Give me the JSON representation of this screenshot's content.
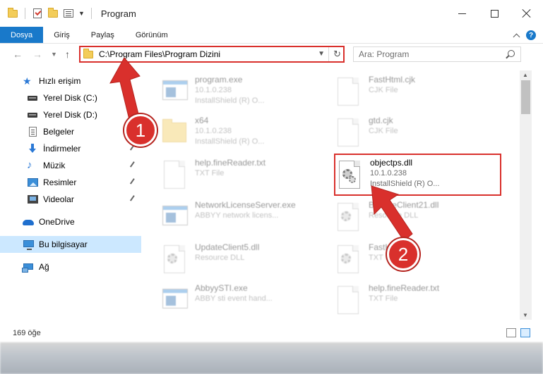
{
  "window": {
    "title": "Program"
  },
  "ribbon": {
    "tabs": [
      "Dosya",
      "Giriş",
      "Paylaş",
      "Görünüm"
    ]
  },
  "address": {
    "path": "C:\\Program Files\\Program Dizini"
  },
  "search": {
    "placeholder": "Ara: Program"
  },
  "sidebar": {
    "items": [
      {
        "label": "Hızlı erişim",
        "icon": "star-icon"
      },
      {
        "label": "Yerel Disk (C:)",
        "icon": "drive-icon"
      },
      {
        "label": "Yerel Disk (D:)",
        "icon": "drive-icon"
      },
      {
        "label": "Belgeler",
        "icon": "documents-icon"
      },
      {
        "label": "İndirmeler",
        "icon": "download-icon"
      },
      {
        "label": "Müzik",
        "icon": "music-icon"
      },
      {
        "label": "Resimler",
        "icon": "pictures-icon"
      },
      {
        "label": "Videolar",
        "icon": "videos-icon"
      },
      {
        "label": "OneDrive",
        "icon": "onedrive-icon"
      },
      {
        "label": "Bu bilgisayar",
        "icon": "computer-icon"
      },
      {
        "label": "Ağ",
        "icon": "network-icon"
      }
    ]
  },
  "files": [
    {
      "name": "program.exe",
      "line1": "10.1.0.238",
      "line2": "InstallShield (R) O...",
      "icon": "exe-icon"
    },
    {
      "name": "FastHtml.cjk",
      "line1": "CJK File",
      "line2": "",
      "icon": "file-icon"
    },
    {
      "name": "x64",
      "line1": "10.1.0.238",
      "line2": "InstallShield (R) O...",
      "icon": "folder-icon"
    },
    {
      "name": "gtd.cjk",
      "line1": "CJK File",
      "line2": "",
      "icon": "file-icon"
    },
    {
      "name": "help.fineReader.txt",
      "line1": "TXT File",
      "line2": "",
      "icon": "file-icon"
    },
    {
      "name": "objectps.dll",
      "line1": "10.1.0.238",
      "line2": "InstallShield (R) O...",
      "icon": "dll-icon"
    },
    {
      "name": "NetworkLicenseServer.exe",
      "line1": "ABBYY network licens...",
      "line2": "",
      "icon": "exe-icon"
    },
    {
      "name": "BrowseClient21.dll",
      "line1": "Resource DLL",
      "line2": "",
      "icon": "dll-icon"
    },
    {
      "name": "UpdateClient5.dll",
      "line1": "Resource DLL",
      "line2": "",
      "icon": "dll-icon"
    },
    {
      "name": "FastKey.dll",
      "line1": "TXT File",
      "line2": "",
      "icon": "dll-icon"
    },
    {
      "name": "AbbyySTI.exe",
      "line1": "ABBY sti event hand...",
      "line2": "",
      "icon": "exe-icon"
    },
    {
      "name": "help.fineReader.txt",
      "line1": "TXT File",
      "line2": "",
      "icon": "file-icon"
    }
  ],
  "status": {
    "item_count": "169 öğe"
  },
  "annotations": {
    "step1": "1",
    "step2": "2"
  },
  "colors": {
    "accent": "#1979ca",
    "highlight": "#d9302c",
    "selected": "#cce8ff"
  }
}
